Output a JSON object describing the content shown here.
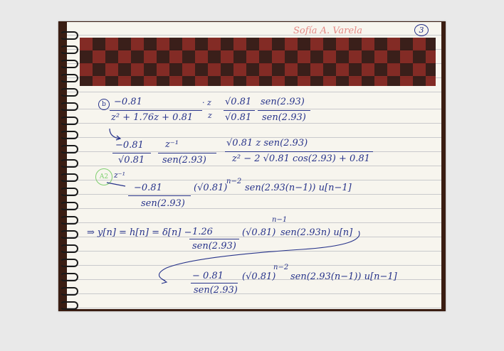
{
  "header": {
    "author": "Sofía A. Varela",
    "page_number": "3"
  },
  "notes": {
    "item_b_marker": "b",
    "line1_num": "−0.81",
    "line1_den": "z² + 1.76z + 0.81",
    "line1_dot_num": "· z",
    "line1_dot_den": "z",
    "line1_sqrt_num": "√0.81",
    "line1_sqrt_den": "√0.81",
    "line1_sen_num": "sen(2.93)",
    "line1_sen_den": "sen(2.93)",
    "line2_num": "−0.81",
    "line2_den": "√0.81",
    "line2_zinv_num": "z⁻¹",
    "line2_zinv_den": "sen(2.93)",
    "line2_frac_num": "√0.81 z sen(2.93)",
    "line2_frac_den": "z² − 2 √0.81 cos(2.93) + 0.81",
    "a2_marker": "A2",
    "line3_zinv": "z⁻¹",
    "line3_a": "−0.81",
    "line3_b": "(√0.81)",
    "line3_b_exp": "n−2",
    "line3_c": "sen(2.93(n−1)) u[n−1]",
    "line3_den": "sen(2.93)",
    "line4_lhs": "⇒ y[n] = h[n] = δ[n] −",
    "line4_num": "1.26",
    "line4_den": "sen(2.93)",
    "line4_b": "(√0.81)",
    "line4_b_exp": "n−1",
    "line4_c": "sen(2.93n) u[n]",
    "line5_num": "− 0.81",
    "line5_den": "sen(2.93)",
    "line5_b": "(√0.81)",
    "line5_b_exp": "n−2",
    "line5_c": "sen(2.93(n−1)) u[n−1]"
  }
}
